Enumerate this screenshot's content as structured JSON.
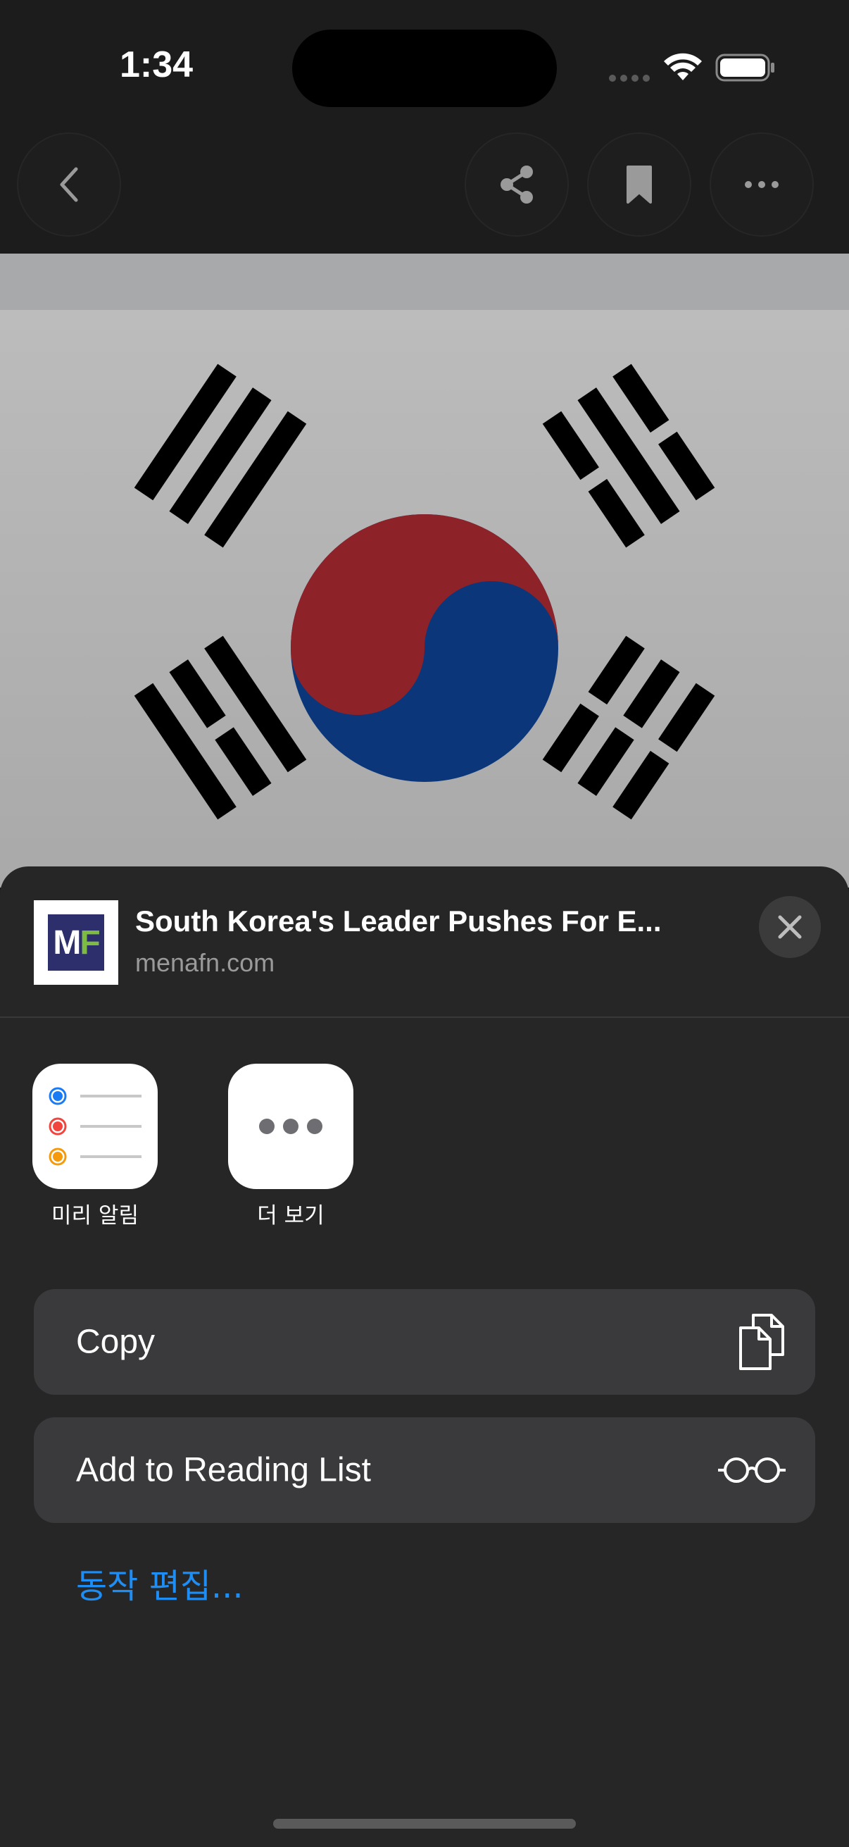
{
  "status_bar": {
    "time": "1:34",
    "icons": [
      "signal-dots-icon",
      "wifi-icon",
      "battery-icon"
    ]
  },
  "toolbar": {
    "buttons": [
      "back-icon",
      "share-icon",
      "bookmark-icon",
      "more-icon"
    ]
  },
  "web_content": {
    "image": "south-korea-flag"
  },
  "share_sheet": {
    "title": "South Korea's Leader Pushes For E...",
    "domain": "menafn.com",
    "thumbnail_text": {
      "m": "M",
      "f": "F"
    },
    "apps": [
      {
        "label": "미리 알림",
        "icon": "reminders-icon"
      },
      {
        "label": "더 보기",
        "icon": "more-apps-icon"
      }
    ],
    "actions": [
      {
        "label": "Copy",
        "icon": "copy-icon"
      },
      {
        "label": "Add to Reading List",
        "icon": "reading-list-glasses-icon"
      }
    ],
    "edit_actions": "동작 편집..."
  },
  "colors": {
    "background": "#1c1c1c",
    "sheet": "#262626",
    "action_row": "#3a3a3c",
    "link": "#1e8ef5",
    "flag_red": "#8e2229",
    "flag_blue": "#0b377a"
  }
}
